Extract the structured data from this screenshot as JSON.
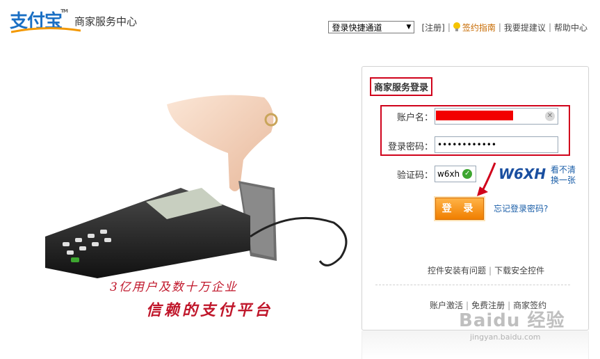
{
  "header": {
    "logo_text": "支付宝",
    "logo_tm": "TM",
    "subtitle": "商家服务中心",
    "quick_select": "登录快捷通道",
    "register": "[注册]",
    "guide": "签约指南",
    "suggest": "我要提建议",
    "help": "帮助中心"
  },
  "hero": {
    "slogan_line1": "3亿用户及数十万企业",
    "slogan_line2": "信赖的支付平台"
  },
  "login": {
    "title": "商家服务登录",
    "account_label": "账户名：",
    "password_label": "登录密码：",
    "password_value": "••••••••••••",
    "captcha_label": "验证码：",
    "captcha_value": "w6xh",
    "captcha_image_text": "W6XH",
    "refresh_line1": "看不清",
    "refresh_line2": "换一张",
    "login_button": "登 录",
    "forgot": "忘记登录密码?",
    "links_top": [
      "控件安装有问题",
      "下载安全控件"
    ],
    "links_bottom": [
      "账户激活",
      "免费注册",
      "商家签约"
    ]
  },
  "watermark": {
    "brand": "Baidu 经验",
    "url": "jingyan.baidu.com"
  },
  "colors": {
    "brand_blue": "#1a6fc4",
    "highlight_red": "#d0021b",
    "button_orange": "#f07f00",
    "link_blue": "#1a5ea8"
  }
}
